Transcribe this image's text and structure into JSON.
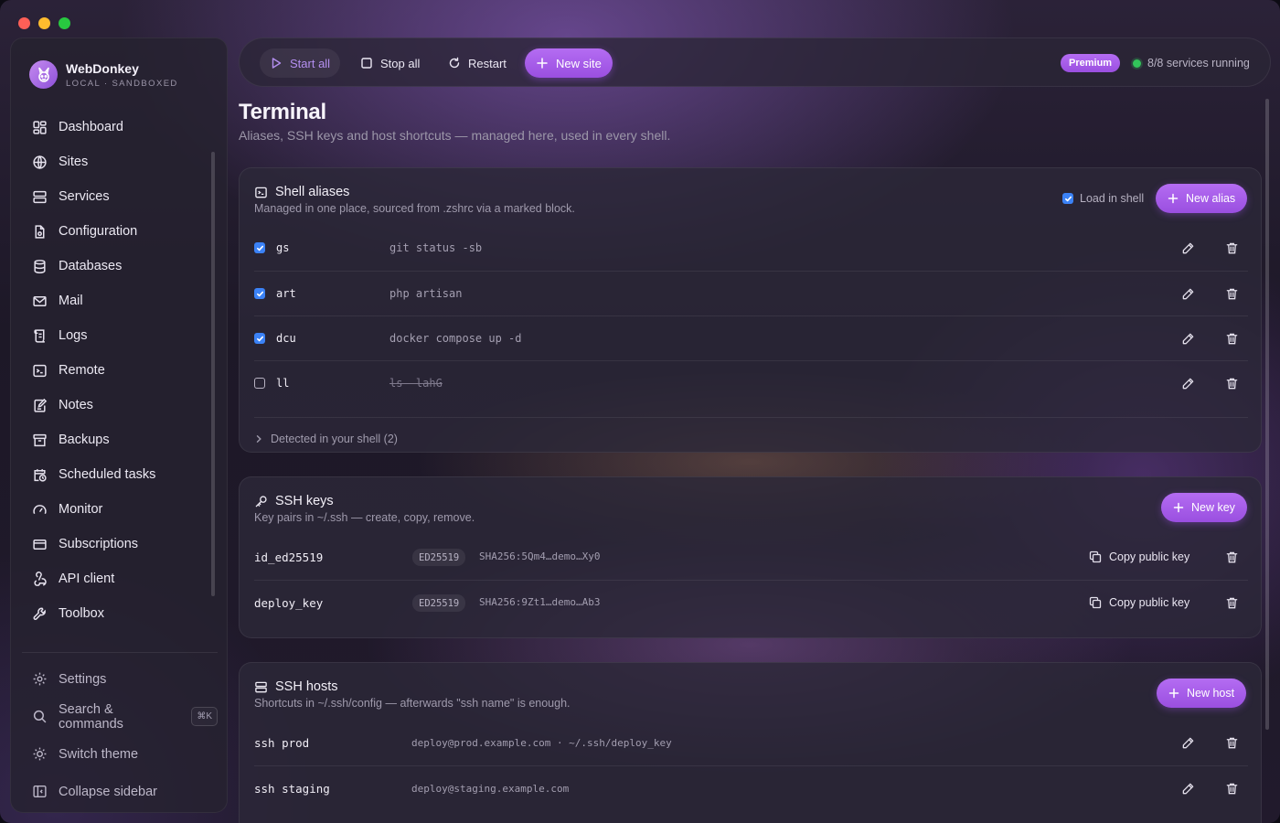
{
  "app": {
    "name": "WebDonkey",
    "tagline": "LOCAL · SANDBOXED"
  },
  "sidebar": {
    "items": [
      {
        "label": "Dashboard",
        "icon": "dashboard-icon"
      },
      {
        "label": "Sites",
        "icon": "globe-icon"
      },
      {
        "label": "Services",
        "icon": "server-icon"
      },
      {
        "label": "Configuration",
        "icon": "config-file-icon"
      },
      {
        "label": "Databases",
        "icon": "database-icon"
      },
      {
        "label": "Mail",
        "icon": "mail-icon"
      },
      {
        "label": "Logs",
        "icon": "scroll-icon"
      },
      {
        "label": "Remote",
        "icon": "terminal-icon"
      },
      {
        "label": "Notes",
        "icon": "note-edit-icon"
      },
      {
        "label": "Backups",
        "icon": "archive-icon"
      },
      {
        "label": "Scheduled tasks",
        "icon": "calendar-clock-icon"
      },
      {
        "label": "Monitor",
        "icon": "gauge-icon"
      },
      {
        "label": "Subscriptions",
        "icon": "credit-card-icon"
      },
      {
        "label": "API client",
        "icon": "webhook-icon"
      },
      {
        "label": "Toolbox",
        "icon": "wrench-icon"
      }
    ],
    "footer": {
      "settings": "Settings",
      "search": "Search & commands",
      "search_shortcut": "⌘K",
      "theme": "Switch theme",
      "collapse": "Collapse sidebar"
    }
  },
  "toolbar": {
    "start_all": "Start all",
    "stop_all": "Stop all",
    "restart": "Restart",
    "new_site": "New site",
    "premium_badge": "Premium",
    "status_text": "8/8 services running",
    "status_color": "#32c45a",
    "accent_color": "#a45ce8"
  },
  "page": {
    "title": "Terminal",
    "subtitle": "Aliases, SSH keys and host shortcuts — managed here, used in every shell."
  },
  "aliases": {
    "title": "Shell aliases",
    "subtitle": "Managed in one place, sourced from .zshrc via a marked block.",
    "load_in_shell_label": "Load in shell",
    "load_in_shell": true,
    "new_button": "New alias",
    "rows": [
      {
        "name": "gs",
        "command": "git status -sb",
        "enabled": true
      },
      {
        "name": "art",
        "command": "php artisan",
        "enabled": true
      },
      {
        "name": "dcu",
        "command": "docker compose up -d",
        "enabled": true
      },
      {
        "name": "ll",
        "command": "ls -lahG",
        "enabled": false
      }
    ],
    "detected_label": "Detected in your shell (2)"
  },
  "ssh_keys": {
    "title": "SSH keys",
    "subtitle": "Key pairs in ~/.ssh — create, copy, remove.",
    "new_button": "New key",
    "copy_label": "Copy public key",
    "rows": [
      {
        "name": "id_ed25519",
        "type": "ED25519",
        "fingerprint": "SHA256:5Qm4…demo…Xy0"
      },
      {
        "name": "deploy_key",
        "type": "ED25519",
        "fingerprint": "SHA256:9Zt1…demo…Ab3"
      }
    ]
  },
  "ssh_hosts": {
    "title": "SSH hosts",
    "subtitle": "Shortcuts in ~/.ssh/config — afterwards \"ssh name\" is enough.",
    "new_button": "New host",
    "rows": [
      {
        "name": "ssh prod",
        "detail": "deploy@prod.example.com · ~/.ssh/deploy_key"
      },
      {
        "name": "ssh staging",
        "detail": "deploy@staging.example.com"
      }
    ]
  }
}
